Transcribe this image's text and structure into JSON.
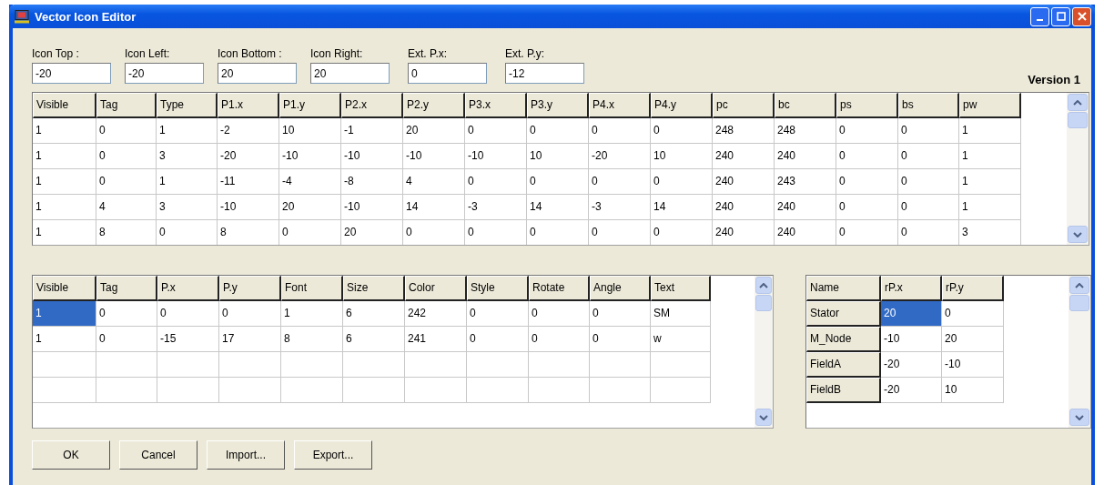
{
  "window": {
    "title": "Vector Icon Editor"
  },
  "fields": [
    {
      "label": "Icon Top :",
      "value": "-20"
    },
    {
      "label": "Icon Left:",
      "value": "-20"
    },
    {
      "label": "Icon Bottom :",
      "value": "20"
    },
    {
      "label": "Icon Right:",
      "value": "20"
    },
    {
      "label": "Ext. P.x:",
      "value": "0"
    },
    {
      "label": "Ext. P.y:",
      "value": "-12"
    }
  ],
  "version": "Version 1",
  "shapes_table": {
    "columns": [
      "Visible",
      "Tag",
      "Type",
      "P1.x",
      "P1.y",
      "P2.x",
      "P2.y",
      "P3.x",
      "P3.y",
      "P4.x",
      "P4.y",
      "pc",
      "bc",
      "ps",
      "bs",
      "pw"
    ],
    "rows": [
      [
        "1",
        "0",
        "1",
        "-2",
        "10",
        "-1",
        "20",
        "0",
        "0",
        "0",
        "0",
        "248",
        "248",
        "0",
        "0",
        "1"
      ],
      [
        "1",
        "0",
        "3",
        "-20",
        "-10",
        "-10",
        "-10",
        "-10",
        "10",
        "-20",
        "10",
        "240",
        "240",
        "0",
        "0",
        "1"
      ],
      [
        "1",
        "0",
        "1",
        "-11",
        "-4",
        "-8",
        "4",
        "0",
        "0",
        "0",
        "0",
        "240",
        "243",
        "0",
        "0",
        "1"
      ],
      [
        "1",
        "4",
        "3",
        "-10",
        "20",
        "-10",
        "14",
        "-3",
        "14",
        "-3",
        "14",
        "240",
        "240",
        "0",
        "0",
        "1"
      ],
      [
        "1",
        "8",
        "0",
        "8",
        "0",
        "20",
        "0",
        "0",
        "0",
        "0",
        "0",
        "240",
        "240",
        "0",
        "0",
        "3"
      ]
    ]
  },
  "text_table": {
    "columns": [
      "Visible",
      "Tag",
      "P.x",
      "P.y",
      "Font",
      "Size",
      "Color",
      "Style",
      "Rotate",
      "Angle",
      "Text"
    ],
    "rows": [
      [
        {
          "text": "1",
          "selected": true
        },
        {
          "text": "0",
          "selected": false
        },
        {
          "text": "0",
          "selected": false
        },
        {
          "text": "0",
          "selected": false
        },
        {
          "text": "1",
          "selected": false
        },
        {
          "text": "6",
          "selected": false
        },
        {
          "text": "242",
          "selected": false
        },
        {
          "text": "0",
          "selected": false
        },
        {
          "text": "0",
          "selected": false
        },
        {
          "text": "0",
          "selected": false
        },
        {
          "text": "SM",
          "selected": false
        }
      ],
      [
        {
          "text": "1",
          "selected": false
        },
        {
          "text": "0",
          "selected": false
        },
        {
          "text": "-15",
          "selected": false
        },
        {
          "text": "17",
          "selected": false
        },
        {
          "text": "8",
          "selected": false
        },
        {
          "text": "6",
          "selected": false
        },
        {
          "text": "241",
          "selected": false
        },
        {
          "text": "0",
          "selected": false
        },
        {
          "text": "0",
          "selected": false
        },
        {
          "text": "0",
          "selected": false
        },
        {
          "text": "w",
          "selected": false
        }
      ]
    ]
  },
  "points_table": {
    "columns": [
      "Name",
      "rP.x",
      "rP.y"
    ],
    "rows": [
      [
        {
          "kind": "header",
          "text": "Stator"
        },
        {
          "kind": "value",
          "text": "20",
          "selected": true
        },
        {
          "kind": "value",
          "text": "0",
          "selected": false
        }
      ],
      [
        {
          "kind": "header",
          "text": "M_Node"
        },
        {
          "kind": "value",
          "text": "-10",
          "selected": false
        },
        {
          "kind": "value",
          "text": "20",
          "selected": false
        }
      ],
      [
        {
          "kind": "header",
          "text": "FieldA"
        },
        {
          "kind": "value",
          "text": "-20",
          "selected": false
        },
        {
          "kind": "value",
          "text": "-10",
          "selected": false
        }
      ],
      [
        {
          "kind": "header",
          "text": "FieldB"
        },
        {
          "kind": "value",
          "text": "-20",
          "selected": false
        },
        {
          "kind": "value",
          "text": "10",
          "selected": false
        }
      ]
    ]
  },
  "buttons": [
    "OK",
    "Cancel",
    "Import...",
    "Export..."
  ]
}
